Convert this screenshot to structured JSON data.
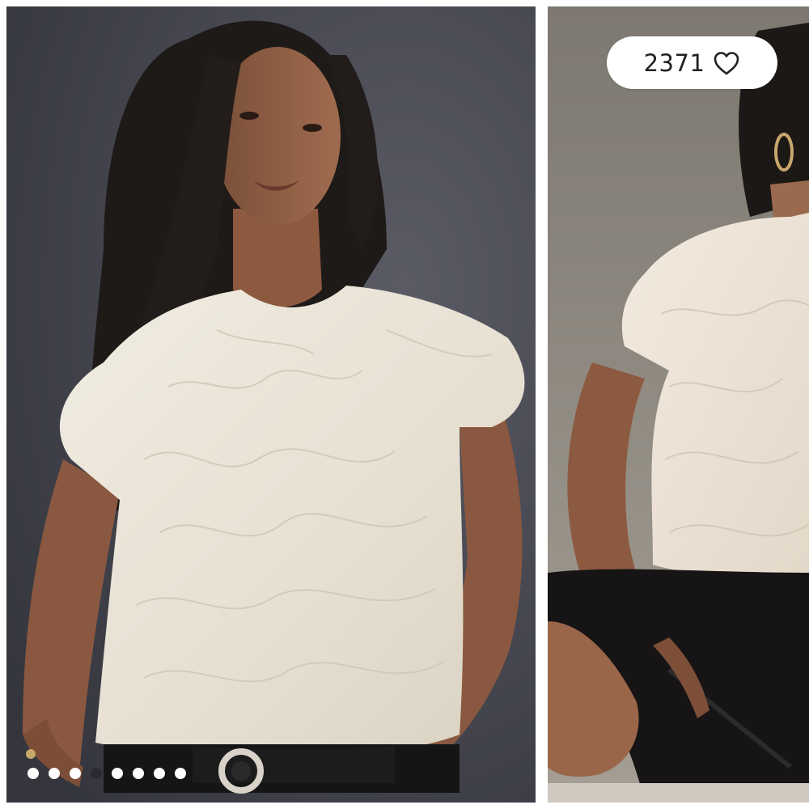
{
  "gallery": {
    "like_count": "2371",
    "like_icon": "heart-outline-icon",
    "slide_count": 8,
    "active_slide_index": 3,
    "photos": [
      {
        "subject": "model-wearing-cream-faux-fur-top-standing"
      },
      {
        "subject": "model-wearing-cream-faux-fur-top-seated"
      }
    ]
  },
  "colors": {
    "background_main": "#3e3f47",
    "background_side": "#8a857d",
    "garment": "#ece6da",
    "pill": "#ffffff",
    "dot": "#ffffff",
    "dot_active": "#2a2b33"
  }
}
